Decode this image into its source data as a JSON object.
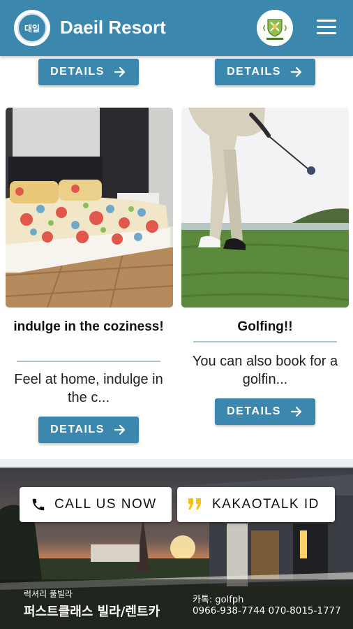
{
  "header": {
    "logo_text": "대일",
    "title": "Daeil Resort",
    "partner_logo_caption": "Paradise Golf",
    "menu_icon": "hamburger-menu-icon",
    "color": "#3c87ad"
  },
  "top_row": {
    "left_button": "DETAILS",
    "right_button": "DETAILS"
  },
  "cards": [
    {
      "title": "indulge in the coziness!",
      "description": "Feel at home, indulge in the c...",
      "button": "DETAILS"
    },
    {
      "title": "Golfing!!",
      "description": "You can also book for a golfin...",
      "button": "DETAILS"
    }
  ],
  "footer": {
    "call_button": "CALL US NOW",
    "kakao_button": "KAKAOTALK ID",
    "sub_label": "럭셔리 풀빌라",
    "main_label": "퍼스트클래스 빌라/렌트카",
    "kakao_id": "카톡: golfph",
    "phones": "0966-938-7744 070-8015-1777"
  }
}
